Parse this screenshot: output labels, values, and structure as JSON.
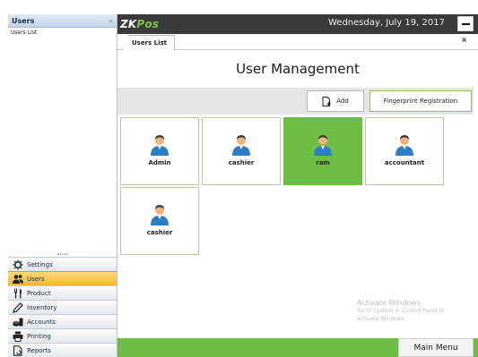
{
  "left_panel": {
    "title": "Users",
    "collapse_glyph": "«",
    "items": [
      "Users List"
    ]
  },
  "nav": [
    {
      "label": "Settings",
      "icon": "gear-icon"
    },
    {
      "label": "Users",
      "icon": "users-icon",
      "active": true
    },
    {
      "label": "Product",
      "icon": "fork-knife-icon"
    },
    {
      "label": "Inventory",
      "icon": "pencil-icon"
    },
    {
      "label": "Accounts",
      "icon": "accounts-icon"
    },
    {
      "label": "Printing",
      "icon": "printer-icon"
    },
    {
      "label": "Reports",
      "icon": "reports-icon"
    }
  ],
  "header": {
    "logo_main": "ZK",
    "logo_accent": "Pos",
    "date": "Wednesday, July 19, 2017"
  },
  "tab": {
    "label": "Users List",
    "close_glyph": "×"
  },
  "page": {
    "title": "User Management"
  },
  "toolbar": {
    "add_label": "Add",
    "fingerprint_label": "Fingerprint Registration"
  },
  "users": [
    {
      "name": "Admin"
    },
    {
      "name": "cashier"
    },
    {
      "name": "ram",
      "selected": true
    },
    {
      "name": "accountant"
    },
    {
      "name": "cashier"
    }
  ],
  "watermark": {
    "line1": "Activate Windows",
    "line2": "Go to System in Control Panel to",
    "line3": "activate Windows."
  },
  "footer": {
    "main_menu_label": "Main Menu"
  },
  "colors": {
    "accent_green": "#6ebd45",
    "active_nav": "#f8b832",
    "top_bar": "#3a3a3a"
  }
}
